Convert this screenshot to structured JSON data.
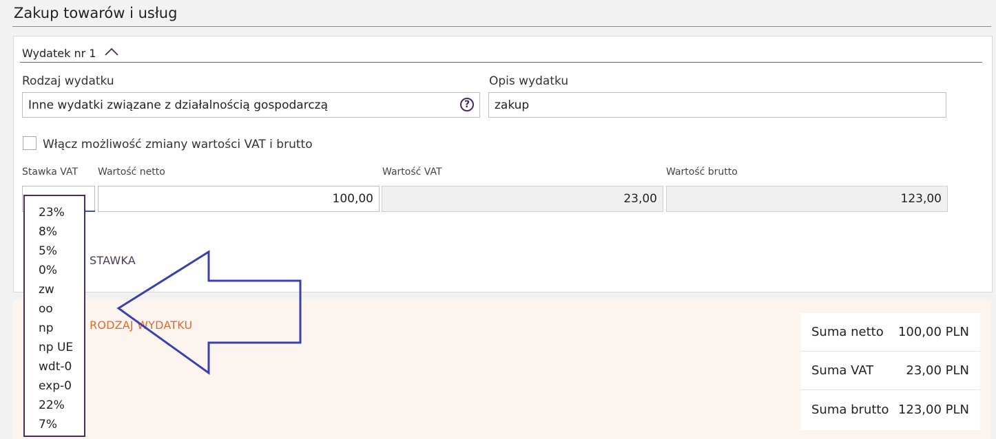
{
  "section": {
    "title": "Zakup towarów i usług"
  },
  "expense": {
    "header": "Wydatek nr 1",
    "type_label": "Rodzaj wydatku",
    "type_value": "Inne wydatki związane z działalnością gospodarczą",
    "desc_label": "Opis wydatku",
    "desc_value": "zakup",
    "checkbox_label": "Włącz możliwość zmiany wartości VAT i brutto",
    "vat_rate_label": "Stawka VAT",
    "net_label": "Wartość netto",
    "net_value": "100,00",
    "vat_label": "Wartość VAT",
    "vat_value": "23,00",
    "gross_label": "Wartość brutto",
    "gross_value": "123,00",
    "add_rate_partial": "STAWKA"
  },
  "vat_options": [
    "23%",
    "8%",
    "5%",
    "0%",
    "zw",
    "oo",
    "np",
    "np UE",
    "wdt-0",
    "exp-0",
    "22%",
    "7%"
  ],
  "add_type_partial": "RODZAJ WYDATKU",
  "summary": {
    "net_label": "Suma netto",
    "net_value": "100,00 PLN",
    "vat_label": "Suma VAT",
    "vat_value": "23,00 PLN",
    "gross_label": "Suma brutto",
    "gross_value": "123,00 PLN"
  },
  "colors": {
    "accent": "#4a2a5a",
    "link_orange": "#e26a2a",
    "arrow": "#3a3fb0",
    "summary_bg": "#fcf4ef"
  },
  "icons": [
    "chevron-up-icon",
    "question-mark-icon",
    "arrow-left-icon"
  ]
}
